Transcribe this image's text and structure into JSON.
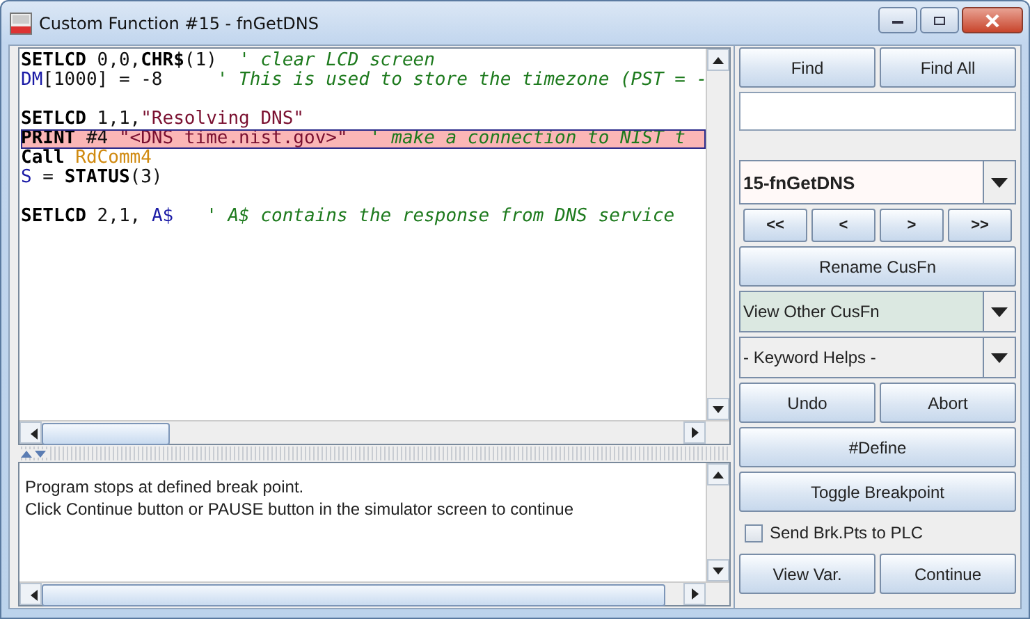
{
  "window": {
    "title": "Custom Function #15 - fnGetDNS"
  },
  "editor": {
    "lines": [
      {
        "kind": "code",
        "breakpoint": false,
        "tokens": [
          {
            "kind": "kw",
            "t": "SETLCD"
          },
          {
            "kind": "plain",
            "t": " 0,0,"
          },
          {
            "kind": "kw",
            "t": "CHR$"
          },
          {
            "kind": "plain",
            "t": "(1)  "
          },
          {
            "kind": "comment",
            "t": "' clear LCD screen"
          }
        ]
      },
      {
        "kind": "code",
        "breakpoint": false,
        "tokens": [
          {
            "kind": "var",
            "t": "DM"
          },
          {
            "kind": "plain",
            "t": "[1000] = -8     "
          },
          {
            "kind": "comment",
            "t": "' This is used to store the timezone (PST = -"
          }
        ]
      },
      {
        "kind": "blank"
      },
      {
        "kind": "code",
        "breakpoint": false,
        "tokens": [
          {
            "kind": "kw",
            "t": "SETLCD"
          },
          {
            "kind": "plain",
            "t": " 1,1,"
          },
          {
            "kind": "string",
            "t": "\"Resolving DNS\""
          }
        ]
      },
      {
        "kind": "code",
        "breakpoint": true,
        "tokens": [
          {
            "kind": "kw",
            "t": "PRINT"
          },
          {
            "kind": "plain",
            "t": " #4 "
          },
          {
            "kind": "string",
            "t": "\"<DNS time.nist.gov>\""
          },
          {
            "kind": "comment",
            "t": "  ' make a connection to NIST t"
          }
        ]
      },
      {
        "kind": "code",
        "breakpoint": false,
        "tokens": [
          {
            "kind": "kw",
            "t": "Call "
          },
          {
            "kind": "call",
            "t": "RdComm4"
          }
        ]
      },
      {
        "kind": "code",
        "breakpoint": false,
        "tokens": [
          {
            "kind": "var",
            "t": "S"
          },
          {
            "kind": "plain",
            "t": " = "
          },
          {
            "kind": "kw",
            "t": "STATUS"
          },
          {
            "kind": "plain",
            "t": "(3)"
          }
        ]
      },
      {
        "kind": "blank"
      },
      {
        "kind": "code",
        "breakpoint": false,
        "tokens": [
          {
            "kind": "kw",
            "t": "SETLCD"
          },
          {
            "kind": "plain",
            "t": " 2,1, "
          },
          {
            "kind": "var",
            "t": "A$"
          },
          {
            "kind": "comment",
            "t": "   ' A$ contains the response from DNS service"
          }
        ]
      }
    ]
  },
  "output": {
    "lines": [
      "Program stops at defined break point.",
      "Click Continue button or PAUSE button in the simulator screen to continue"
    ]
  },
  "sidebar": {
    "find_buttons": [
      "Find",
      "Find All"
    ],
    "function_select": {
      "value": "15-fnGetDNS"
    },
    "nav_buttons": [
      "<<",
      "<",
      ">",
      ">>"
    ],
    "rename_button": "Rename CusFn",
    "view_other_select": {
      "value": "View Other CusFn"
    },
    "keyword_select": {
      "value": "- Keyword Helps -"
    },
    "edit_buttons": [
      "Undo",
      "Abort"
    ],
    "define_button": "#Define",
    "breakpoint_button": "Toggle Breakpoint",
    "send_breakpoints": {
      "label": "Send Brk.Pts to PLC",
      "checked": false
    },
    "bottom_buttons": [
      "View Var.",
      "Continue"
    ]
  }
}
